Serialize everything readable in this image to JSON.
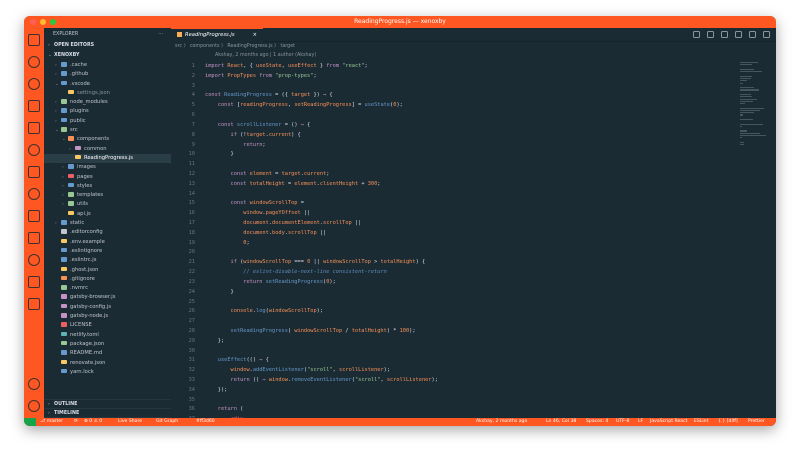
{
  "window": {
    "title": "ReadingProgress.js — xenoxby"
  },
  "sidebar": {
    "header": "EXPLORER",
    "more": "···",
    "open_editors": "OPEN EDITORS",
    "project": "XENOXBY",
    "tree": [
      {
        "label": ".cache",
        "indent": 1,
        "chev": "›",
        "color": "#6699cc"
      },
      {
        "label": ".github",
        "indent": 1,
        "chev": "›",
        "color": "#6699cc"
      },
      {
        "label": ".vscode",
        "indent": 1,
        "chev": "⌄",
        "color": "#6699cc"
      },
      {
        "label": "settings.json",
        "indent": 2,
        "chev": "",
        "color": "#fac863",
        "muted": true
      },
      {
        "label": "node_modules",
        "indent": 1,
        "chev": "›",
        "color": "#99c794"
      },
      {
        "label": "plugins",
        "indent": 1,
        "chev": "›",
        "color": "#6699cc"
      },
      {
        "label": "public",
        "indent": 1,
        "chev": "›",
        "color": "#6699cc"
      },
      {
        "label": "src",
        "indent": 1,
        "chev": "⌄",
        "color": "#99c794"
      },
      {
        "label": "components",
        "indent": 2,
        "chev": "⌄",
        "color": "#f99157"
      },
      {
        "label": "common",
        "indent": 3,
        "chev": "›",
        "color": "#c594c5"
      },
      {
        "label": "ReadingProgress.js",
        "indent": 3,
        "chev": "",
        "color": "#fac863",
        "selected": true
      },
      {
        "label": "images",
        "indent": 2,
        "chev": "›",
        "color": "#6699cc"
      },
      {
        "label": "pages",
        "indent": 2,
        "chev": "›",
        "color": "#ec5f67"
      },
      {
        "label": "styles",
        "indent": 2,
        "chev": "›",
        "color": "#6699cc"
      },
      {
        "label": "templates",
        "indent": 2,
        "chev": "›",
        "color": "#99c794"
      },
      {
        "label": "utils",
        "indent": 2,
        "chev": "›",
        "color": "#99c794"
      },
      {
        "label": "api.js",
        "indent": 2,
        "chev": "",
        "color": "#fac863"
      },
      {
        "label": "static",
        "indent": 1,
        "chev": "›",
        "color": "#6699cc"
      },
      {
        "label": ".editorconfig",
        "indent": 1,
        "chev": "",
        "color": "#c0c5ce"
      },
      {
        "label": ".env.example",
        "indent": 1,
        "chev": "",
        "color": "#fac863"
      },
      {
        "label": ".eslintignore",
        "indent": 1,
        "chev": "",
        "color": "#6699cc"
      },
      {
        "label": ".eslintrc.js",
        "indent": 1,
        "chev": "",
        "color": "#6699cc"
      },
      {
        "label": ".ghost.json",
        "indent": 1,
        "chev": "",
        "color": "#fac863"
      },
      {
        "label": ".gitignore",
        "indent": 1,
        "chev": "",
        "color": "#f99157"
      },
      {
        "label": ".nvmrc",
        "indent": 1,
        "chev": "",
        "color": "#99c794"
      },
      {
        "label": "gatsby-browser.js",
        "indent": 1,
        "chev": "",
        "color": "#c594c5"
      },
      {
        "label": "gatsby-config.js",
        "indent": 1,
        "chev": "",
        "color": "#c594c5"
      },
      {
        "label": "gatsby-node.js",
        "indent": 1,
        "chev": "",
        "color": "#c594c5"
      },
      {
        "label": "LICENSE",
        "indent": 1,
        "chev": "",
        "color": "#ec5f67"
      },
      {
        "label": "netlify.toml",
        "indent": 1,
        "chev": "",
        "color": "#5fb3b3"
      },
      {
        "label": "package.json",
        "indent": 1,
        "chev": "",
        "color": "#99c794"
      },
      {
        "label": "README.md",
        "indent": 1,
        "chev": "",
        "color": "#6699cc"
      },
      {
        "label": "renovate.json",
        "indent": 1,
        "chev": "",
        "color": "#fac863"
      },
      {
        "label": "yarn.lock",
        "indent": 1,
        "chev": "",
        "color": "#6699cc"
      }
    ],
    "outline": "OUTLINE",
    "timeline": "TIMELINE",
    "npm_scripts": "NPM SCRIPTS"
  },
  "editor": {
    "tab_label": "ReadingProgress.js",
    "tab_close": "×",
    "breadcrumb": "src 〉 components 〉 ReadingProgress.js 〉 target",
    "blame": "Akshay, 2 months ago | 1 author (Akshay)"
  },
  "code": [
    {
      "n": "1",
      "parts": [
        [
          "k",
          "import "
        ],
        [
          "v",
          "React"
        ],
        [
          "t",
          ", { "
        ],
        [
          "v",
          "useState"
        ],
        [
          "t",
          ", "
        ],
        [
          "v",
          "useEffect"
        ],
        [
          "t",
          " } "
        ],
        [
          "k",
          "from "
        ],
        [
          "s",
          "\"react\""
        ],
        [
          "t",
          ";"
        ]
      ]
    },
    {
      "n": "2",
      "parts": [
        [
          "k",
          "import "
        ],
        [
          "v",
          "PropTypes "
        ],
        [
          "k",
          "from "
        ],
        [
          "s",
          "\"prop-types\""
        ],
        [
          "t",
          ";"
        ]
      ]
    },
    {
      "n": "3",
      "parts": []
    },
    {
      "n": "4",
      "parts": [
        [
          "k",
          "const "
        ],
        [
          "f",
          "ReadingProgress"
        ],
        [
          "t",
          " = ({ "
        ],
        [
          "v",
          "target"
        ],
        [
          "t",
          " }) "
        ],
        [
          "k",
          "⇒ "
        ],
        [
          "t",
          "{"
        ]
      ]
    },
    {
      "n": "5",
      "parts": [
        [
          "t",
          "    "
        ],
        [
          "k",
          "const "
        ],
        [
          "t",
          "["
        ],
        [
          "v",
          "readingProgress"
        ],
        [
          "t",
          ", "
        ],
        [
          "v",
          "setReadingProgress"
        ],
        [
          "t",
          "] = "
        ],
        [
          "f",
          "useState"
        ],
        [
          "t",
          "("
        ],
        [
          "n",
          "0"
        ],
        [
          "t",
          ");"
        ]
      ]
    },
    {
      "n": "6",
      "parts": []
    },
    {
      "n": "7",
      "parts": [
        [
          "t",
          "    "
        ],
        [
          "k",
          "const "
        ],
        [
          "f",
          "scrollListener"
        ],
        [
          "t",
          " = () "
        ],
        [
          "k",
          "⇒ "
        ],
        [
          "t",
          "{"
        ]
      ]
    },
    {
      "n": "8",
      "parts": [
        [
          "t",
          "        "
        ],
        [
          "k",
          "if "
        ],
        [
          "t",
          "(!"
        ],
        [
          "v",
          "target"
        ],
        [
          "t",
          "."
        ],
        [
          "v",
          "current"
        ],
        [
          "t",
          ") {"
        ]
      ]
    },
    {
      "n": "9",
      "parts": [
        [
          "t",
          "            "
        ],
        [
          "k",
          "return"
        ],
        [
          "t",
          ";"
        ]
      ]
    },
    {
      "n": "10",
      "parts": [
        [
          "t",
          "        }"
        ]
      ]
    },
    {
      "n": "11",
      "parts": []
    },
    {
      "n": "12",
      "parts": [
        [
          "t",
          "        "
        ],
        [
          "k",
          "const "
        ],
        [
          "v",
          "element"
        ],
        [
          "t",
          " = "
        ],
        [
          "v",
          "target"
        ],
        [
          "t",
          "."
        ],
        [
          "v",
          "current"
        ],
        [
          "t",
          ";"
        ]
      ]
    },
    {
      "n": "13",
      "parts": [
        [
          "t",
          "        "
        ],
        [
          "k",
          "const "
        ],
        [
          "v",
          "totalHeight"
        ],
        [
          "t",
          " = "
        ],
        [
          "v",
          "element"
        ],
        [
          "t",
          "."
        ],
        [
          "v",
          "clientHeight"
        ],
        [
          "t",
          " + "
        ],
        [
          "n",
          "300"
        ],
        [
          "t",
          ";"
        ]
      ]
    },
    {
      "n": "14",
      "parts": []
    },
    {
      "n": "15",
      "parts": [
        [
          "t",
          "        "
        ],
        [
          "k",
          "const "
        ],
        [
          "v",
          "windowScrollTop"
        ],
        [
          "t",
          " ="
        ]
      ]
    },
    {
      "n": "16",
      "parts": [
        [
          "t",
          "            "
        ],
        [
          "v",
          "window"
        ],
        [
          "t",
          "."
        ],
        [
          "v",
          "pageYOffset"
        ],
        [
          "t",
          " ||"
        ]
      ]
    },
    {
      "n": "17",
      "parts": [
        [
          "t",
          "            "
        ],
        [
          "v",
          "document"
        ],
        [
          "t",
          "."
        ],
        [
          "v",
          "documentElement"
        ],
        [
          "t",
          "."
        ],
        [
          "v",
          "scrollTop"
        ],
        [
          "t",
          " ||"
        ]
      ]
    },
    {
      "n": "18",
      "parts": [
        [
          "t",
          "            "
        ],
        [
          "v",
          "document"
        ],
        [
          "t",
          "."
        ],
        [
          "v",
          "body"
        ],
        [
          "t",
          "."
        ],
        [
          "v",
          "scrollTop"
        ],
        [
          "t",
          " ||"
        ]
      ]
    },
    {
      "n": "19",
      "parts": [
        [
          "t",
          "            "
        ],
        [
          "n",
          "0"
        ],
        [
          "t",
          ";"
        ]
      ]
    },
    {
      "n": "20",
      "parts": []
    },
    {
      "n": "21",
      "parts": [
        [
          "t",
          "        "
        ],
        [
          "k",
          "if "
        ],
        [
          "t",
          "("
        ],
        [
          "v",
          "windowScrollTop"
        ],
        [
          "t",
          " === "
        ],
        [
          "n",
          "0"
        ],
        [
          "t",
          " || "
        ],
        [
          "v",
          "windowScrollTop"
        ],
        [
          "t",
          " > "
        ],
        [
          "v",
          "totalHeight"
        ],
        [
          "t",
          ") {"
        ]
      ]
    },
    {
      "n": "22",
      "parts": [
        [
          "t",
          "            "
        ],
        [
          "c",
          "// eslint-disable-next-line consistent-return"
        ]
      ]
    },
    {
      "n": "23",
      "parts": [
        [
          "t",
          "            "
        ],
        [
          "k",
          "return "
        ],
        [
          "f",
          "setReadingProgress"
        ],
        [
          "t",
          "("
        ],
        [
          "n",
          "0"
        ],
        [
          "t",
          ");"
        ]
      ]
    },
    {
      "n": "24",
      "parts": [
        [
          "t",
          "        }"
        ]
      ]
    },
    {
      "n": "25",
      "parts": []
    },
    {
      "n": "26",
      "parts": [
        [
          "t",
          "        "
        ],
        [
          "v",
          "console"
        ],
        [
          "t",
          "."
        ],
        [
          "f",
          "log"
        ],
        [
          "t",
          "("
        ],
        [
          "v",
          "windowScrollTop"
        ],
        [
          "t",
          ");"
        ]
      ]
    },
    {
      "n": "27",
      "parts": []
    },
    {
      "n": "28",
      "parts": [
        [
          "t",
          "        "
        ],
        [
          "f",
          "setReadingProgress"
        ],
        [
          "t",
          "( "
        ],
        [
          "v",
          "windowScrollTop"
        ],
        [
          "t",
          " / "
        ],
        [
          "v",
          "totalHeight"
        ],
        [
          "t",
          ") * "
        ],
        [
          "n",
          "100"
        ],
        [
          "t",
          ");"
        ]
      ]
    },
    {
      "n": "29",
      "parts": [
        [
          "t",
          "    };"
        ]
      ]
    },
    {
      "n": "30",
      "parts": []
    },
    {
      "n": "31",
      "parts": [
        [
          "t",
          "    "
        ],
        [
          "f",
          "useEffect"
        ],
        [
          "t",
          "(() "
        ],
        [
          "k",
          "⇒ "
        ],
        [
          "t",
          "{"
        ]
      ]
    },
    {
      "n": "32",
      "parts": [
        [
          "t",
          "        "
        ],
        [
          "v",
          "window"
        ],
        [
          "t",
          "."
        ],
        [
          "f",
          "addEventListener"
        ],
        [
          "t",
          "("
        ],
        [
          "s",
          "\"scroll\""
        ],
        [
          "t",
          ", "
        ],
        [
          "v",
          "scrollListener"
        ],
        [
          "t",
          ");"
        ]
      ]
    },
    {
      "n": "33",
      "parts": [
        [
          "t",
          "        "
        ],
        [
          "k",
          "return "
        ],
        [
          "t",
          "() "
        ],
        [
          "k",
          "⇒ "
        ],
        [
          "v",
          "window"
        ],
        [
          "t",
          "."
        ],
        [
          "f",
          "removeEventListener"
        ],
        [
          "t",
          "("
        ],
        [
          "s",
          "\"scroll\""
        ],
        [
          "t",
          ", "
        ],
        [
          "v",
          "scrollListener"
        ],
        [
          "t",
          ");"
        ]
      ]
    },
    {
      "n": "34",
      "parts": [
        [
          "t",
          "    });"
        ]
      ]
    },
    {
      "n": "35",
      "parts": []
    },
    {
      "n": "36",
      "parts": [
        [
          "t",
          "    "
        ],
        [
          "k",
          "return "
        ],
        [
          "t",
          "("
        ]
      ]
    },
    {
      "n": "37",
      "parts": [
        [
          "t",
          "        "
        ],
        [
          "e",
          "<div"
        ]
      ]
    }
  ],
  "status": {
    "branch": "master",
    "sync": "⟳",
    "problems": "⊗ 0 ⚠ 0",
    "live_share": "Live Share",
    "git_graph": "Git Graph",
    "commit": "#ff3d60",
    "blame": "Akshay, 2 months ago",
    "position": "Ln 46, Col 38",
    "spaces": "Spaces: 4",
    "encoding": "UTF-8",
    "eol": "LF",
    "language": "JavaScript React",
    "eslint": "ESLint",
    "diff": "{.} [diff]",
    "prettier": "Prettier"
  },
  "colors": {
    "accent": "#ff5722",
    "editor_bg": "#1b2b34",
    "remote": "#16a34a"
  }
}
